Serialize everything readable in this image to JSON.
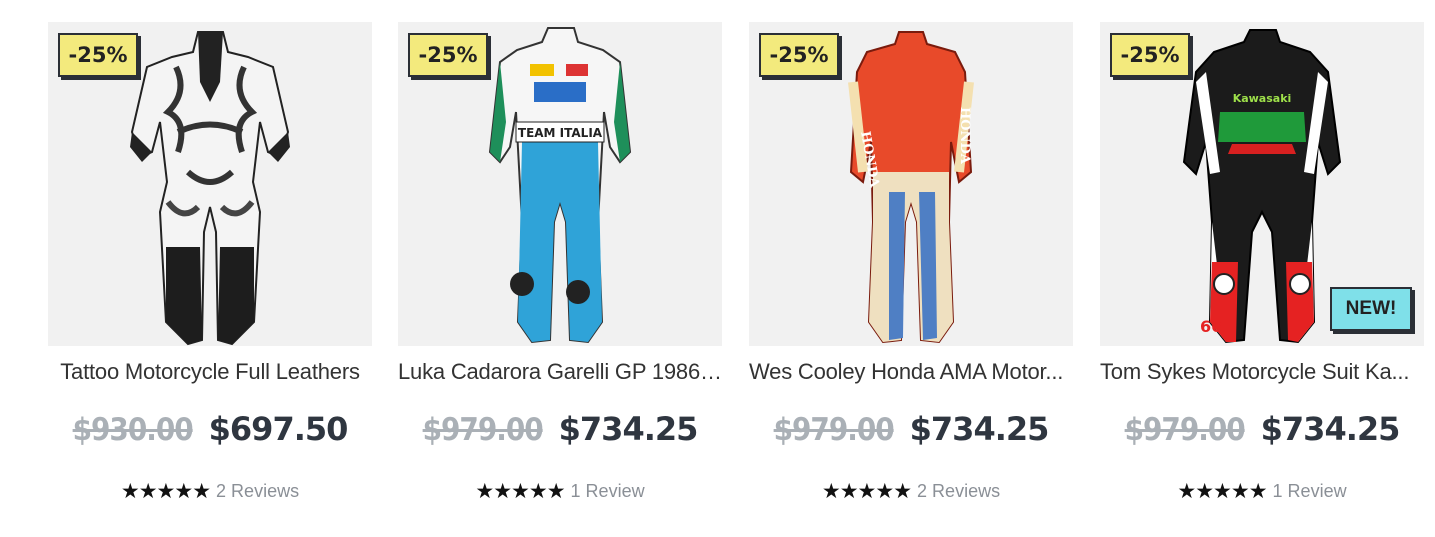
{
  "colors": {
    "sale_badge_bg": "#f3ea7d",
    "new_badge_bg": "#7fe0e9",
    "old_price": "#aab0b6",
    "new_price": "#2f3640"
  },
  "products": [
    {
      "title": "Tattoo Motorcycle Full Leathers",
      "badge": "-25%",
      "old_price": "$930.00",
      "price": "$697.50",
      "stars": "★★★★★",
      "rating": 5,
      "reviews": "2 Reviews",
      "image": "tattoo-suit-image"
    },
    {
      "title": "Luka Cadarora Garelli GP 1986 ...",
      "badge": "-25%",
      "old_price": "$979.00",
      "price": "$734.25",
      "stars": "★★★★★",
      "rating": 5,
      "reviews": "1 Review",
      "image": "team-italia-suit-image"
    },
    {
      "title": "Wes Cooley Honda AMA Motor...",
      "badge": "-25%",
      "old_price": "$979.00",
      "price": "$734.25",
      "stars": "★★★★★",
      "rating": 5,
      "reviews": "2 Reviews",
      "image": "honda-suit-image"
    },
    {
      "title": "Tom Sykes Motorcycle Suit Ka...",
      "badge": "-25%",
      "new_badge": "NEW!",
      "old_price": "$979.00",
      "price": "$734.25",
      "stars": "★★★★★",
      "rating": 5,
      "reviews": "1 Review",
      "image": "kawasaki-suit-image"
    }
  ]
}
